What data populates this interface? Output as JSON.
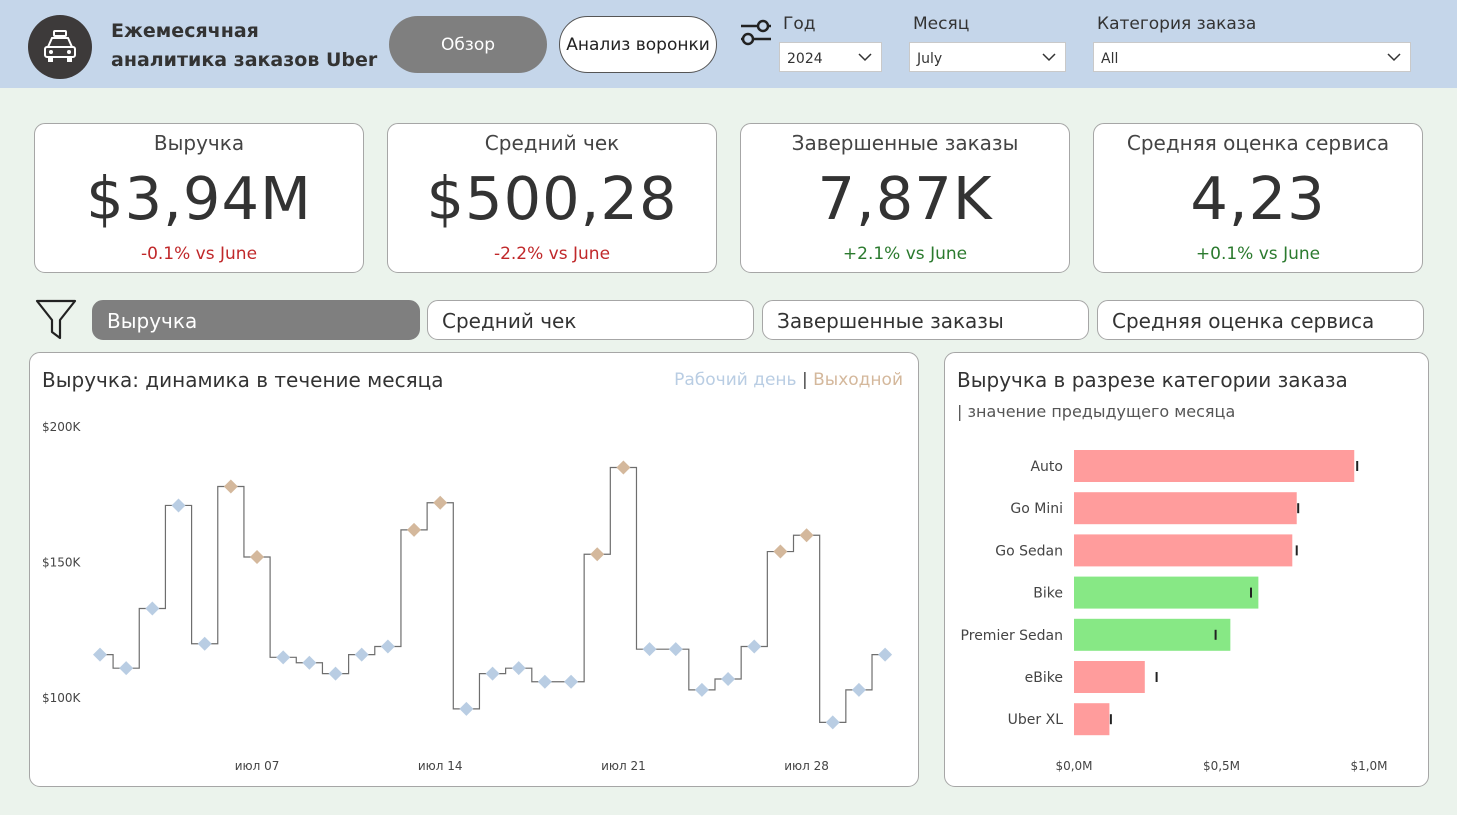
{
  "header": {
    "title": "Ежемесячная аналитика заказов Uber",
    "logo_icon": "car-icon",
    "nav": {
      "overview": "Обзор",
      "funnel": "Анализ воронки"
    },
    "filter_icon": "sliders-icon",
    "filters": {
      "year": {
        "label": "Год",
        "value": "2024"
      },
      "month": {
        "label": "Месяц",
        "value": "July"
      },
      "category": {
        "label": "Категория заказа",
        "value": "All"
      }
    }
  },
  "kpis": [
    {
      "label": "Выручка",
      "value": "$3,94M",
      "delta": "-0.1% vs June",
      "trend": "negative"
    },
    {
      "label": "Средний чек",
      "value": "$500,28",
      "delta": "-2.2% vs June",
      "trend": "negative"
    },
    {
      "label": "Завершенные заказы",
      "value": "7,87K",
      "delta": "+2.1% vs June",
      "trend": "positive"
    },
    {
      "label": "Средняя оценка сервиса",
      "value": "4,23",
      "delta": "+0.1% vs June",
      "trend": "positive"
    }
  ],
  "metric_tabs": {
    "icon": "funnel-icon",
    "items": [
      "Выручка",
      "Средний чек",
      "Завершенные заказы",
      "Средняя оценка сервиса"
    ],
    "active": 0
  },
  "colors": {
    "weekday": "#b9cde3",
    "weekend": "#d4b89c",
    "bar_down": "#ff9c9c",
    "bar_up": "#87e885",
    "accent_gray": "#7f7f7f"
  },
  "line_chart": {
    "title": "Выручка: динамика в течение месяца",
    "legend": {
      "weekday": "Рабочий день",
      "sep": "|",
      "weekend": "Выходной"
    }
  },
  "bar_chart": {
    "title": "Выручка в разрезе категории заказа",
    "subtitle": "| значение предыдущего месяца"
  },
  "chart_data": [
    {
      "type": "line",
      "title": "Выручка: динамика в течение месяца",
      "step": true,
      "x": [
        1,
        2,
        3,
        4,
        5,
        6,
        7,
        8,
        9,
        10,
        11,
        12,
        13,
        14,
        15,
        16,
        17,
        18,
        19,
        20,
        21,
        22,
        23,
        24,
        25,
        26,
        27,
        28,
        29,
        30,
        31
      ],
      "day_type": [
        "weekday",
        "weekday",
        "weekday",
        "weekday",
        "weekday",
        "weekend",
        "weekend",
        "weekday",
        "weekday",
        "weekday",
        "weekday",
        "weekday",
        "weekend",
        "weekend",
        "weekday",
        "weekday",
        "weekday",
        "weekday",
        "weekday",
        "weekend",
        "weekend",
        "weekday",
        "weekday",
        "weekday",
        "weekday",
        "weekday",
        "weekend",
        "weekend",
        "weekday",
        "weekday",
        "weekday"
      ],
      "y": [
        116000,
        111000,
        133000,
        171000,
        120000,
        178000,
        152000,
        115000,
        113000,
        109000,
        116000,
        119000,
        162000,
        172000,
        96000,
        109000,
        111000,
        106000,
        106000,
        153000,
        185000,
        118000,
        118000,
        103000,
        107000,
        119000,
        154000,
        160000,
        91000,
        103000,
        116000
      ],
      "x_ticks": [
        {
          "day": 7,
          "label": "июл 07"
        },
        {
          "day": 14,
          "label": "июл 14"
        },
        {
          "day": 21,
          "label": "июл 21"
        },
        {
          "day": 28,
          "label": "июл 28"
        }
      ],
      "y_ticks": [
        {
          "value": 200000,
          "label": "$200K"
        },
        {
          "value": 150000,
          "label": "$150K"
        },
        {
          "value": 100000,
          "label": "$100K"
        }
      ],
      "ylim": [
        75000,
        210000
      ],
      "legend": [
        "Рабочий день",
        "Выходной"
      ]
    },
    {
      "type": "bar",
      "orientation": "horizontal",
      "title": "Выручка в разрезе категории заказа",
      "categories": [
        "Auto",
        "Go Mini",
        "Go Sedan",
        "Bike",
        "Premier Sedan",
        "eBike",
        "Uber XL"
      ],
      "values": [
        0.95,
        0.755,
        0.74,
        0.625,
        0.53,
        0.24,
        0.12
      ],
      "previous_month": [
        0.96,
        0.76,
        0.755,
        0.6,
        0.48,
        0.28,
        0.125
      ],
      "trend": [
        "down",
        "down",
        "down",
        "up",
        "up",
        "down",
        "down"
      ],
      "x_ticks": [
        {
          "value": 0,
          "label": "$0,0M"
        },
        {
          "value": 0.5,
          "label": "$0,5M"
        },
        {
          "value": 1.0,
          "label": "$1,0M"
        }
      ],
      "xlim": [
        0,
        1.0
      ]
    }
  ]
}
